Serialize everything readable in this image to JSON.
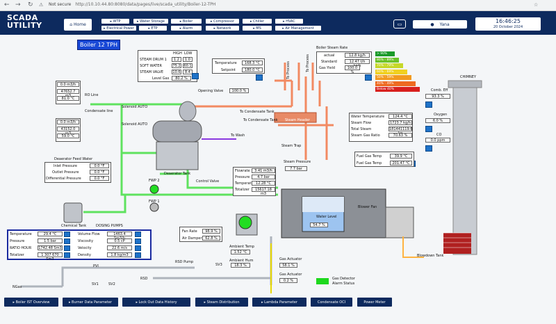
{
  "browser": {
    "not_secure": "Not secure",
    "url": "http://10.10.44.80:8080/data/pages/live/scada_utility/Boiler-12-TPH"
  },
  "header": {
    "logo_line1": "SCADA",
    "logo_line2": "UTILITY",
    "home": "Home",
    "menu_row1": [
      "WTP",
      "Water Storage",
      "Boiler",
      "Compressor",
      "Chiller",
      "HVAC"
    ],
    "menu_row2": [
      "Electrical Power",
      "ETP",
      "Alarm",
      "Network",
      "MS",
      "Air Management"
    ],
    "user": "Yana",
    "time": "16:46:25",
    "date": "20 October 2024"
  },
  "title": "Boiler 12 TPH",
  "steam_table": {
    "col1": "HIGH",
    "col2": "LOW",
    "rows": [
      {
        "label": "STEAM DRUM 1",
        "v1": "1.2",
        "v2": "1.0"
      },
      {
        "label": "SOFT WATER",
        "v1": "75.2",
        "v2": "60.1"
      },
      {
        "label": "STEAM VALVE",
        "v1": "10.6",
        "v2": "8.4"
      }
    ],
    "level_label": "Level Gas",
    "level_value": "80.2 %"
  },
  "temp_panel": {
    "t_label": "Temperature",
    "t_val": "168.3 °C",
    "s_label": "Setpoint",
    "s_val": "180.0 °C"
  },
  "opening_valve": {
    "label": "Opening Valve",
    "value": "100.0 %"
  },
  "co_panel": {
    "title": "Boiler Steam Rate",
    "r1_label": "actual",
    "r1_val": "12.8 kg/h",
    "r2_label": "Standard",
    "r2_val": "12.47 t/h kg/h",
    "r3_label": "Gas Yield",
    "r3_val": "100.0 %"
  },
  "efficiency_bars": [
    {
      "label": "> 90%",
      "color": "#1a9a2a"
    },
    {
      "label": "80% - 89%",
      "color": "#6cc22a"
    },
    {
      "label": "70% - 79%",
      "color": "#c6d82a"
    },
    {
      "label": "60% - 69%",
      "color": "#f0d020"
    },
    {
      "label": "50% - 59%",
      "color": "#f29a20"
    },
    {
      "label": "40% - 49%",
      "color": "#ee6a20"
    },
    {
      "label": "Below 40%",
      "color": "#d8201e"
    }
  ],
  "chimney_label": "CHIMNEY",
  "right_values": {
    "comb_label": "Comb. Eff",
    "comb_val": "93.3 %",
    "o2_label": "Oxygen",
    "o2_val": "6.0 %",
    "co_label": "CO",
    "co_val": "0.0 ppm"
  },
  "ro_panel": {
    "title": "RO Line",
    "flow": "0.0 m3/h",
    "total": "47652.7 m3",
    "temp": "81.0 °C",
    "label": "RO Line",
    "sub": "Condensate line"
  },
  "soft_panel": {
    "flow": "0.0 m3/h",
    "total": "43152.0 m3",
    "temp": "59.0 °C"
  },
  "solenoid": {
    "s1": "Solenoid AUTO",
    "s2": "Solenoid AUTO"
  },
  "condensate_tank": "To Condensate Tank",
  "steam_header": "Steam Header",
  "steam_trap": "Steam Trap",
  "to_process": [
    "To Process",
    "To Process"
  ],
  "to_wash": "To Wash",
  "cond_return": "To Condensate Tank",
  "main_steam": {
    "t1": "Water Temperature",
    "v1": "124.4 °C",
    "t2": "Steam Flow",
    "v2": "1723.7 kg/h",
    "t3": "Total Steam",
    "v3": "181441119.6 kg",
    "t4": "Steam Gas Ratio",
    "v4": "70.63 %"
  },
  "fuel_gas": {
    "l1": "Fuel Gas Temp",
    "v1": "39.9 °C",
    "l2": "Fuel Gas Temp",
    "v2": "201.47 °C"
  },
  "deaerator_panel": {
    "title": "Deaerator Feed Water",
    "l1": "Inlet Pressure",
    "v1": "0.0 °F",
    "l2": "Outlet Pressure",
    "v2": "0.0 °F",
    "l3": "Differential Pressure",
    "v3": "0.0 °F"
  },
  "deaerator_tank": "Deaerator Tank",
  "feedwater": {
    "l1": "Flowrate",
    "v1": "3.41 m3/h",
    "l2": "Pressure",
    "v2": "4.7 bar",
    "l3": "Temperature",
    "v3": "12.28 °C",
    "l4": "Totalizer",
    "v4": "15617.18 m3"
  },
  "steam_pressure": {
    "label": "Steam Pressure",
    "value": "7.7 bar"
  },
  "control_valve": "Control Valve",
  "pumps": {
    "fwp2": "FWP 2",
    "fwp1": "FWP 1",
    "chem_tank": "Chemical Tank",
    "dosing": "DOSING PUMPS"
  },
  "water_level": {
    "label": "Water Level",
    "value": "54.7 %"
  },
  "blower_fan": "Blower Fan",
  "blowdown": "Blowdown Tank",
  "fan_speed": {
    "l1": "Fan Rate",
    "v1": "98.9 %",
    "l2": "Air Damper",
    "v2": "62.8 %"
  },
  "ambient": {
    "label": "Ambient Temp",
    "value": "1.52 °C",
    "l2": "Ambient Hum",
    "v2": "18.3 %"
  },
  "actuators": {
    "g1": "Gas Actuator",
    "v1": "58.1 %",
    "g2": "Gas Actuator",
    "v2": "0.2 %"
  },
  "gas_detector": {
    "label": "Gas Detector",
    "sub": "Alarm Status",
    "color": "#1ed81e"
  },
  "gas_panel": {
    "rows": [
      {
        "a": "Temperature",
        "b": "29.4 °C",
        "c": "Volume Flow",
        "d": "1463.4 Sm3/h"
      },
      {
        "a": "Pressure",
        "b": "1.5 bar",
        "c": "Viscosity",
        "d": "0.5 cP"
      },
      {
        "a": "RATIO HOUR",
        "b": "1742.48 Sm3",
        "c": "Velocity",
        "d": "22.6 m/s"
      },
      {
        "a": "Totalizer",
        "b": "1 307 670 Sm3",
        "c": "Density",
        "d": "1.8 kg/m3"
      }
    ]
  },
  "gas_line": {
    "ngas": "NGas",
    "pvi": "PVI",
    "sv1": "SV1",
    "sv2": "SV2",
    "rsd_pump": "RSD Pump",
    "sv3": "SV3",
    "rsd": "RSD"
  },
  "bottom_buttons": [
    "Boiler IST Overview",
    "Burner Data Parameter",
    "Lock Out Data History",
    "Steam Distribution",
    "Lambda Parameter",
    "Condensate OCI",
    "Power Meter"
  ]
}
